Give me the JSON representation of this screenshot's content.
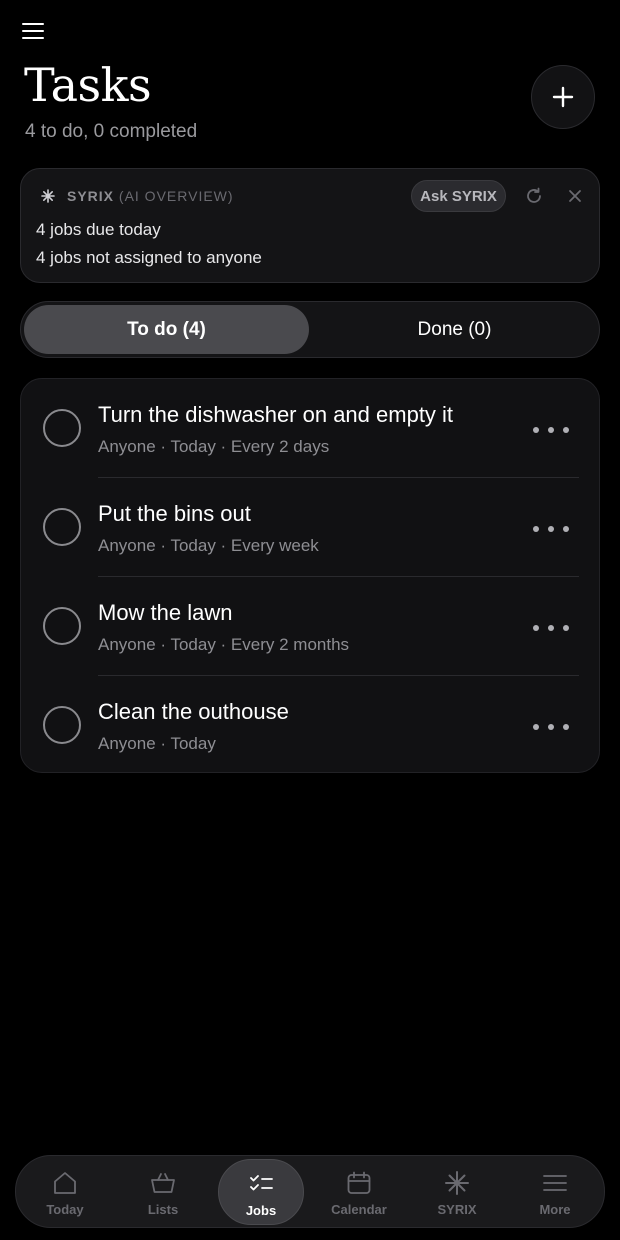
{
  "header": {
    "title": "Tasks",
    "subtitle": "4 to do, 0 completed"
  },
  "ai_overview": {
    "brand": "SYRIX",
    "tag": "(AI OVERVIEW)",
    "ask_label": "Ask SYRIX",
    "lines": [
      "4 jobs due today",
      "4 jobs not assigned to anyone"
    ]
  },
  "segments": {
    "todo_label": "To do (4)",
    "done_label": "Done (0)"
  },
  "tasks": [
    {
      "title": "Turn the dishwasher on and empty it",
      "meta": "Anyone · Today · Every 2 days"
    },
    {
      "title": "Put the bins out",
      "meta": "Anyone · Today · Every week"
    },
    {
      "title": "Mow the lawn",
      "meta": "Anyone · Today · Every 2 months"
    },
    {
      "title": "Clean the outhouse",
      "meta": "Anyone · Today"
    }
  ],
  "nav": {
    "items": [
      {
        "label": "Today",
        "icon": "home-icon"
      },
      {
        "label": "Lists",
        "icon": "basket-icon"
      },
      {
        "label": "Jobs",
        "icon": "checklist-icon"
      },
      {
        "label": "Calendar",
        "icon": "calendar-icon"
      },
      {
        "label": "SYRIX",
        "icon": "syrix-star-icon"
      },
      {
        "label": "More",
        "icon": "menu-icon"
      }
    ],
    "active": "Jobs"
  },
  "colors": {
    "background": "#000000",
    "card": "#141416",
    "active_segment": "#4a4a4e",
    "muted_text": "#8e8e93"
  }
}
